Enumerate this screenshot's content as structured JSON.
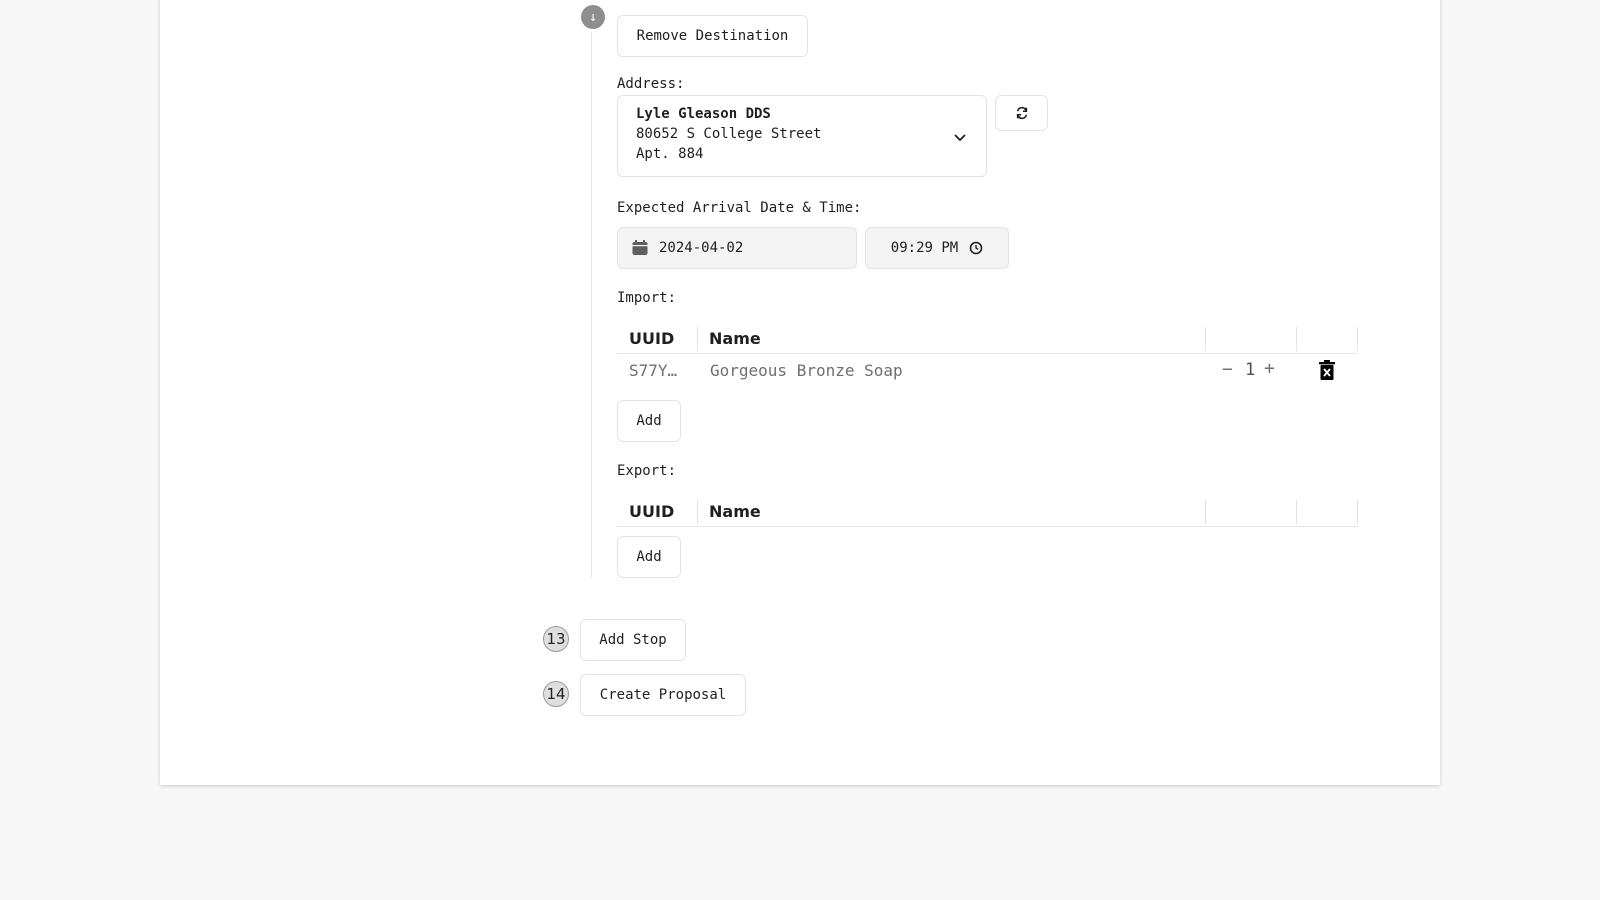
{
  "destination": {
    "remove_label": "Remove Destination",
    "collapse_icon": "arrow-down-icon",
    "address_label": "Address:",
    "address": {
      "name": "Lyle Gleason DDS",
      "street": "80652 S College Street",
      "unit": "Apt. 884"
    },
    "arrival_label": "Expected Arrival Date & Time:",
    "arrival_date": "2024-04-02",
    "arrival_time": "09:29 PM",
    "import": {
      "label": "Import:",
      "columns": [
        "UUID",
        "Name"
      ],
      "rows": [
        {
          "uuid": "S77Y…",
          "name": "Gorgeous Bronze Soap",
          "qty": "1"
        }
      ],
      "add_label": "Add"
    },
    "export": {
      "label": "Export:",
      "columns": [
        "UUID",
        "Name"
      ],
      "add_label": "Add"
    }
  },
  "steps": [
    {
      "number": "13",
      "label": "Add Stop"
    },
    {
      "number": "14",
      "label": "Create Proposal"
    }
  ],
  "colors": {
    "page_bg": "#f7f7f8",
    "card_bg": "#ffffff",
    "border": "#e3e3e3",
    "muted_text": "#6f6f6f"
  }
}
